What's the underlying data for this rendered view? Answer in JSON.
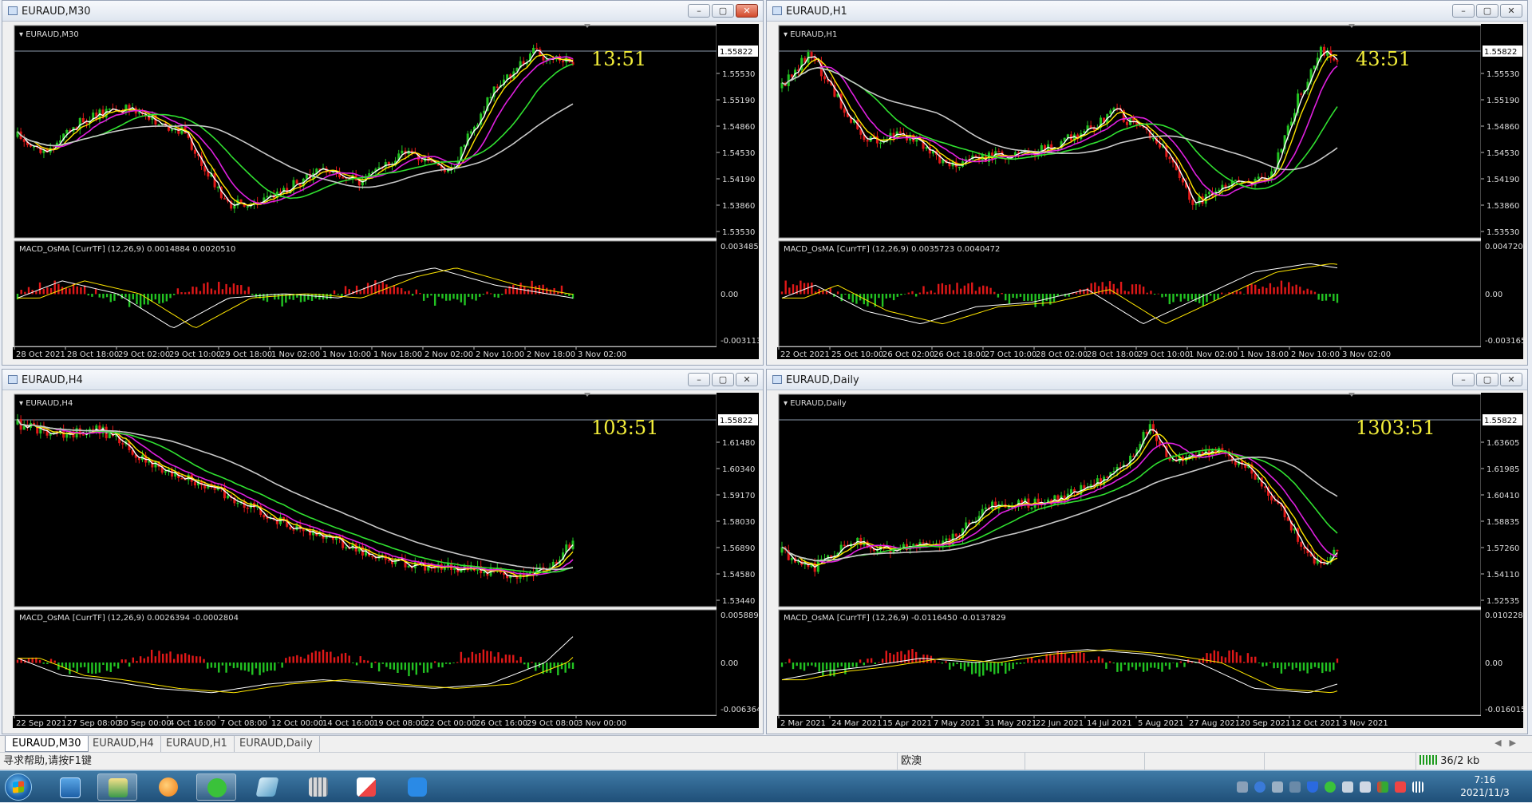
{
  "windows": [
    {
      "id": "m30",
      "title": "EURAUD,M30",
      "chart_label": "EURAUD,M30",
      "timer": "13:51",
      "price_levels": [
        "1.55530",
        "1.55190",
        "1.54860",
        "1.54530",
        "1.54190",
        "1.53860",
        "1.53530"
      ],
      "current_price": "1.55822",
      "indicator_label": "MACD_OsMA [CurrTF] (12,26,9) 0.0014884 0.0020510",
      "indicator_levels": [
        "0.0034859",
        "0.00",
        "-0.003113"
      ],
      "time_labels": [
        "28 Oct 2021",
        "28 Oct 18:00",
        "29 Oct 02:00",
        "29 Oct 10:00",
        "29 Oct 18:00",
        "1 Nov 02:00",
        "1 Nov 10:00",
        "1 Nov 18:00",
        "2 Nov 02:00",
        "2 Nov 10:00",
        "2 Nov 18:00",
        "3 Nov 02:00"
      ]
    },
    {
      "id": "h1",
      "title": "EURAUD,H1",
      "chart_label": "EURAUD,H1",
      "timer": "43:51",
      "price_levels": [
        "1.55530",
        "1.55190",
        "1.54860",
        "1.54530",
        "1.54190",
        "1.53860",
        "1.53530"
      ],
      "current_price": "1.55822",
      "indicator_label": "MACD_OsMA [CurrTF] (12,26,9) 0.0035723 0.0040472",
      "indicator_levels": [
        "0.0047207",
        "0.00",
        "-0.003165"
      ],
      "time_labels": [
        "22 Oct 2021",
        "25 Oct 10:00",
        "26 Oct 02:00",
        "26 Oct 18:00",
        "27 Oct 10:00",
        "28 Oct 02:00",
        "28 Oct 18:00",
        "29 Oct 10:00",
        "1 Nov 02:00",
        "1 Nov 18:00",
        "2 Nov 10:00",
        "3 Nov 02:00"
      ]
    },
    {
      "id": "h4",
      "title": "EURAUD,H4",
      "chart_label": "EURAUD,H4",
      "timer": "103:51",
      "price_levels": [
        "1.61480",
        "1.60340",
        "1.59170",
        "1.58030",
        "1.56890",
        "1.54580",
        "1.53440"
      ],
      "current_price": "1.55822",
      "indicator_label": "MACD_OsMA [CurrTF] (12,26,9) 0.0026394 -0.0002804",
      "indicator_levels": [
        "0.0058891",
        "0.00",
        "-0.006364"
      ],
      "time_labels": [
        "22 Sep 2021",
        "27 Sep 08:00",
        "30 Sep 00:00",
        "4 Oct 16:00",
        "7 Oct 08:00",
        "12 Oct 00:00",
        "14 Oct 16:00",
        "19 Oct 08:00",
        "22 Oct 00:00",
        "26 Oct 16:00",
        "29 Oct 08:00",
        "3 Nov 00:00"
      ]
    },
    {
      "id": "daily",
      "title": "EURAUD,Daily",
      "chart_label": "EURAUD,Daily",
      "timer": "1303:51",
      "price_levels": [
        "1.63605",
        "1.61985",
        "1.60410",
        "1.58835",
        "1.57260",
        "1.54110",
        "1.52535"
      ],
      "current_price": "1.55822",
      "indicator_label": "MACD_OsMA [CurrTF] (12,26,9) -0.0116450 -0.0137829",
      "indicator_levels": [
        "0.0102283",
        "0.00",
        "-0.016015"
      ],
      "time_labels": [
        "2 Mar 2021",
        "24 Mar 2021",
        "15 Apr 2021",
        "7 May 2021",
        "31 May 2021",
        "22 Jun 2021",
        "14 Jul 2021",
        "5 Aug 2021",
        "27 Aug 2021",
        "20 Sep 2021",
        "12 Oct 2021",
        "3 Nov 2021"
      ]
    }
  ],
  "tabs": [
    "EURAUD,M30",
    "EURAUD,H4",
    "EURAUD,H1",
    "EURAUD,Daily"
  ],
  "active_tab": 0,
  "status": {
    "help": "寻求帮助,请按F1键",
    "profile": "欧澳",
    "traffic": "36/2 kb"
  },
  "clock": {
    "time": "7:16",
    "date": "2021/11/3"
  },
  "taskbar_apps": [
    "computer-icon",
    "explorer-icon",
    "browser-icon",
    "wechat-icon",
    "book-icon",
    "calculator-icon",
    "paint-icon",
    "note-icon"
  ],
  "colors": {
    "chart_bg": "#000000",
    "bull_candle": "#22c322",
    "bear_candle": "#e01818",
    "ma_white": "#ffffff",
    "ma_yellow": "#ffe600",
    "ma_magenta": "#e020e0",
    "ma_green": "#30e030",
    "ma_gray": "#c8c8c8",
    "timer_text": "#f4ef3a"
  }
}
